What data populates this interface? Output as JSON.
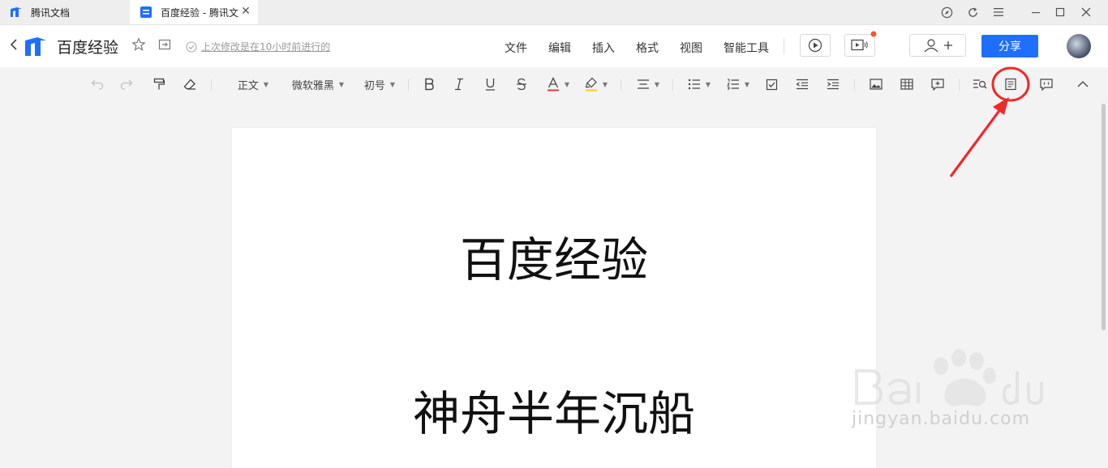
{
  "tabs": [
    {
      "label": "腾讯文档"
    },
    {
      "label": "百度经验 - 腾讯文"
    }
  ],
  "header": {
    "doc_title": "百度经验",
    "save_status": "上次修改是在10小时前进行的",
    "menus": [
      "文件",
      "编辑",
      "插入",
      "格式",
      "视图",
      "智能工具"
    ],
    "share_label": "分享"
  },
  "toolbar": {
    "style_label": "正文",
    "font_label": "微软雅黑",
    "size_label": "初号"
  },
  "document": {
    "line1": "百度经验",
    "line2": "神舟半年沉船"
  },
  "watermark": {
    "text": "jingyan.baidu.com"
  },
  "colors": {
    "accent": "#1e6fff",
    "annotation": "#ee2a2a",
    "font_color_bar": "#e53935",
    "highlight_bar": "#f5d100"
  }
}
